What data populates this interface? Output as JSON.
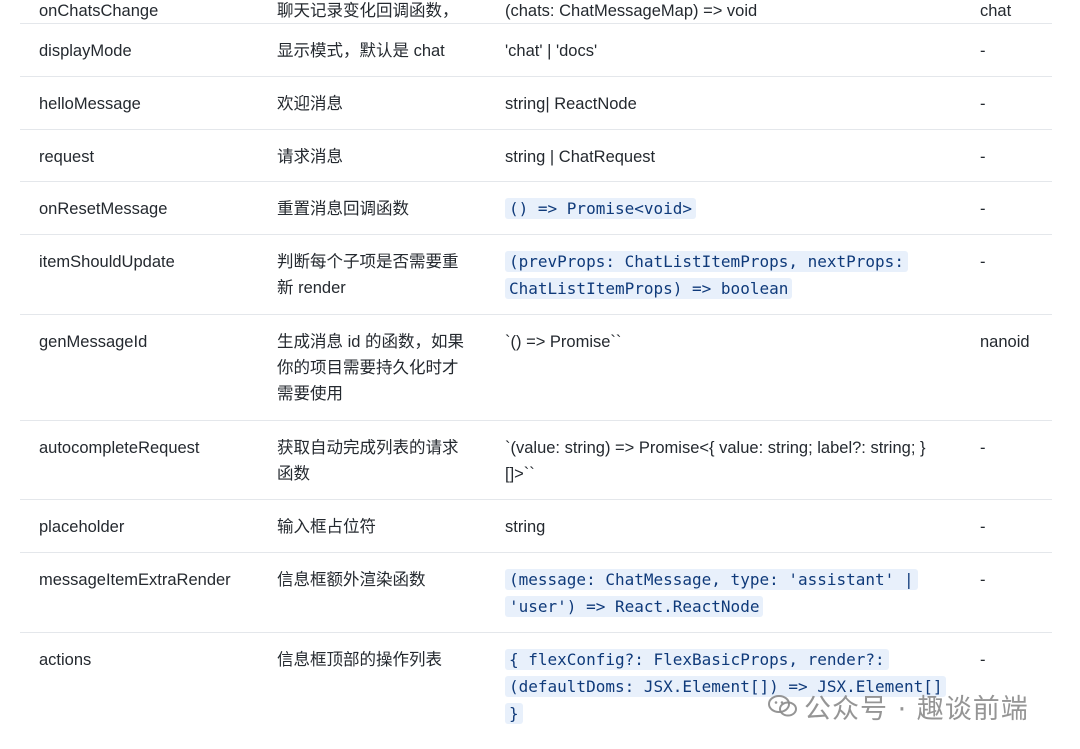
{
  "rows": [
    {
      "name": "onChatsChange",
      "desc": "聊天记录变化回调函数，",
      "type": "(chats: ChatMessageMap) => void",
      "type_is_code": false,
      "default": "chat"
    },
    {
      "name": "displayMode",
      "desc": "显示模式，默认是 chat",
      "type": "'chat' | 'docs'",
      "type_is_code": false,
      "default": "-"
    },
    {
      "name": "helloMessage",
      "desc": "欢迎消息",
      "type": "string| ReactNode",
      "type_is_code": false,
      "default": "-"
    },
    {
      "name": "request",
      "desc": "请求消息",
      "type": "string | ChatRequest",
      "type_is_code": false,
      "default": "-"
    },
    {
      "name": "onResetMessage",
      "desc": "重置消息回调函数",
      "type": "() => Promise<void>",
      "type_is_code": true,
      "default": "-"
    },
    {
      "name": "itemShouldUpdate",
      "desc": "判断每个子项是否需要重新 render",
      "type": "(prevProps: ChatListItemProps, nextProps: ChatListItemProps) => boolean",
      "type_is_code": true,
      "default": "-"
    },
    {
      "name": "genMessageId",
      "desc": "生成消息 id 的函数，如果你的项目需要持久化时才需要使用",
      "type": "`() => Promise``",
      "type_is_code": false,
      "default": "nanoid"
    },
    {
      "name": "autocompleteRequest",
      "desc": "获取自动完成列表的请求函数",
      "type": "`(value: string) => Promise<{ value: string; label?: string; }[]>``",
      "type_is_code": false,
      "default": "-"
    },
    {
      "name": "placeholder",
      "desc": "输入框占位符",
      "type": "string",
      "type_is_code": false,
      "default": "-"
    },
    {
      "name": "messageItemExtraRender",
      "desc": "信息框额外渲染函数",
      "type": "(message: ChatMessage, type: 'assistant' | 'user') => React.ReactNode",
      "type_is_code": true,
      "default": "-"
    },
    {
      "name": "actions",
      "desc": "信息框顶部的操作列表",
      "type": "{ flexConfig?: FlexBasicProps, render?: (defaultDoms: JSX.Element[]) => JSX.Element[] }",
      "type_is_code": true,
      "default": "-"
    }
  ],
  "watermark": {
    "text": "公众号 · 趣谈前端",
    "icon": "wechat-icon"
  }
}
